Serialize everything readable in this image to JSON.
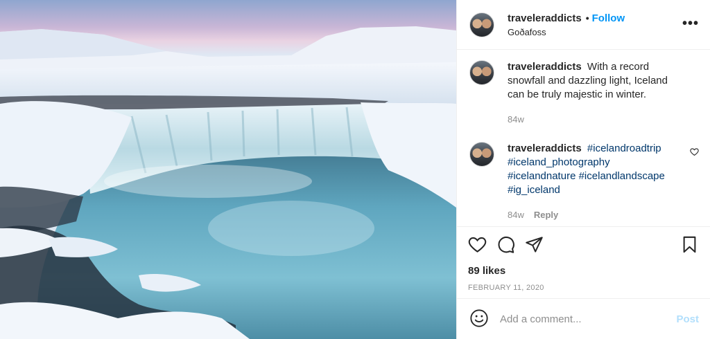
{
  "post": {
    "username": "traveleraddicts",
    "dot": "•",
    "follow_label": "Follow",
    "location": "Goðafoss",
    "more_label": "•••"
  },
  "caption": {
    "username": "traveleraddicts",
    "text": "With a record snowfall and dazzling light, Iceland can be truly majestic in winter.",
    "age": "84w"
  },
  "comments": [
    {
      "username": "traveleraddicts",
      "tags": [
        "#icelandroadtrip",
        "#iceland_photography",
        "#icelandnature",
        "#icelandlandscape",
        "#ig_iceland"
      ],
      "age": "84w",
      "reply_label": "Reply"
    }
  ],
  "stats": {
    "likes": "89 likes",
    "date": "FEBRUARY 11, 2020"
  },
  "add_comment": {
    "placeholder": "Add a comment...",
    "post_label": "Post"
  },
  "icons": {
    "like": "heart-icon",
    "comment": "comment-icon",
    "share": "paper-plane-icon",
    "save": "bookmark-icon",
    "emoji": "emoji-icon",
    "comment_like": "heart-icon"
  },
  "colors": {
    "accent": "#0095f6",
    "hashtag": "#00376b",
    "muted": "#8e8e8e",
    "post_disabled": "#b2dffc"
  }
}
